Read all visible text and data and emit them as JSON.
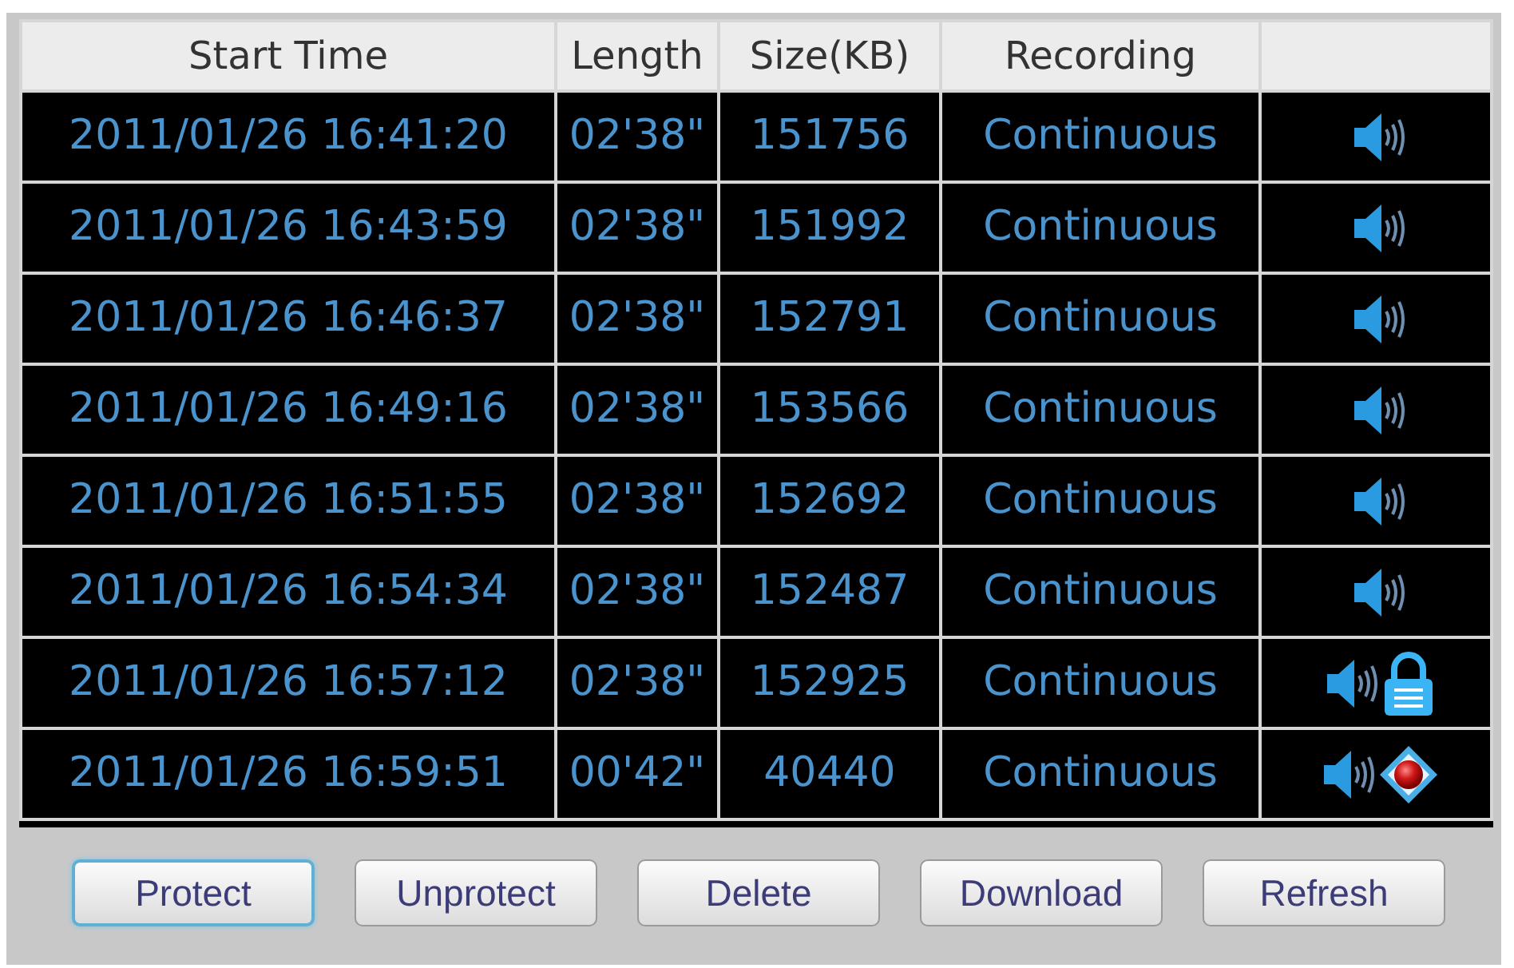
{
  "table": {
    "columns": [
      "Start Time",
      "Length",
      "Size(KB)",
      "Recording"
    ],
    "rows": [
      {
        "start_time": "2011/01/26 16:41:20",
        "length": "02'38\"",
        "size": "151756",
        "recording": "Continuous",
        "protected": false,
        "in_progress": false
      },
      {
        "start_time": "2011/01/26 16:43:59",
        "length": "02'38\"",
        "size": "151992",
        "recording": "Continuous",
        "protected": false,
        "in_progress": false
      },
      {
        "start_time": "2011/01/26 16:46:37",
        "length": "02'38\"",
        "size": "152791",
        "recording": "Continuous",
        "protected": false,
        "in_progress": false
      },
      {
        "start_time": "2011/01/26 16:49:16",
        "length": "02'38\"",
        "size": "153566",
        "recording": "Continuous",
        "protected": false,
        "in_progress": false
      },
      {
        "start_time": "2011/01/26 16:51:55",
        "length": "02'38\"",
        "size": "152692",
        "recording": "Continuous",
        "protected": false,
        "in_progress": false
      },
      {
        "start_time": "2011/01/26 16:54:34",
        "length": "02'38\"",
        "size": "152487",
        "recording": "Continuous",
        "protected": false,
        "in_progress": false
      },
      {
        "start_time": "2011/01/26 16:57:12",
        "length": "02'38\"",
        "size": "152925",
        "recording": "Continuous",
        "protected": true,
        "in_progress": false
      },
      {
        "start_time": "2011/01/26 16:59:51",
        "length": "00'42\"",
        "size": "40440",
        "recording": "Continuous",
        "protected": false,
        "in_progress": true
      }
    ]
  },
  "buttons": [
    {
      "label": "Protect",
      "focused": true
    },
    {
      "label": "Unprotect",
      "focused": false
    },
    {
      "label": "Delete",
      "focused": false
    },
    {
      "label": "Download",
      "focused": false
    },
    {
      "label": "Refresh",
      "focused": false
    }
  ]
}
